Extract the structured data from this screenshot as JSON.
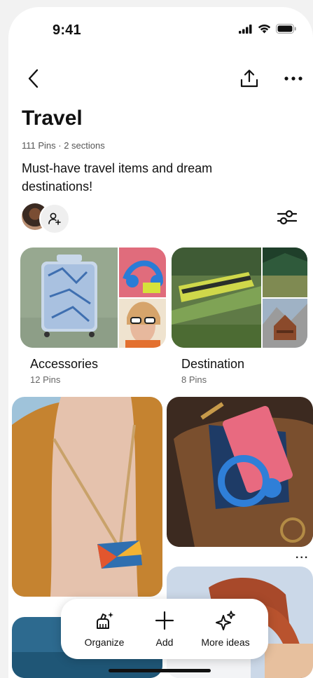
{
  "status_bar": {
    "time": "9:41"
  },
  "board": {
    "title": "Travel",
    "meta": "111 Pins · 2 sections",
    "description": "Must-have travel items and dream destinations!"
  },
  "sections": [
    {
      "title": "Accessories",
      "count": "12 Pins"
    },
    {
      "title": "Destination",
      "count": "8 Pins"
    }
  ],
  "action_bar": {
    "organize_label": "Organize",
    "add_label": "Add",
    "more_ideas_label": "More ideas"
  },
  "pin_menu": {
    "dots": "..."
  }
}
